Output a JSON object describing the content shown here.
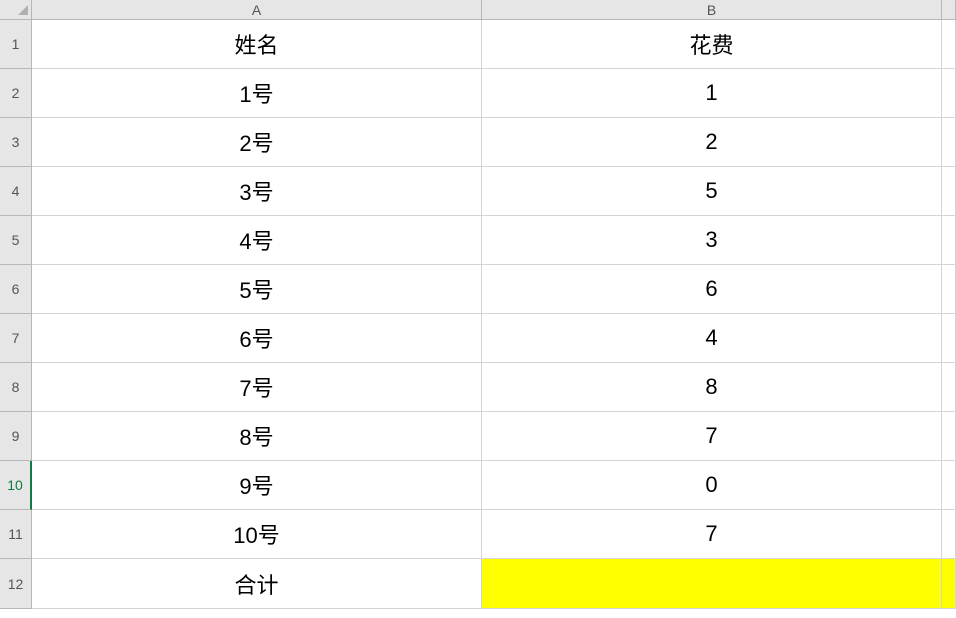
{
  "columns": {
    "A": "A",
    "B": "B"
  },
  "row_numbers": [
    "1",
    "2",
    "3",
    "4",
    "5",
    "6",
    "7",
    "8",
    "9",
    "10",
    "11",
    "12"
  ],
  "table": {
    "header": {
      "name": "姓名",
      "cost": "花费"
    },
    "rows": [
      {
        "name": "1号",
        "cost": "1"
      },
      {
        "name": "2号",
        "cost": "2"
      },
      {
        "name": "3号",
        "cost": "5"
      },
      {
        "name": "4号",
        "cost": "3"
      },
      {
        "name": "5号",
        "cost": "6"
      },
      {
        "name": "6号",
        "cost": "4"
      },
      {
        "name": "7号",
        "cost": "8"
      },
      {
        "name": "8号",
        "cost": "7"
      },
      {
        "name": "9号",
        "cost": "0"
      },
      {
        "name": "10号",
        "cost": "7"
      }
    ],
    "footer": {
      "name": "合计",
      "cost": ""
    }
  },
  "selected_row": "10",
  "highlight_cell": "B12",
  "colors": {
    "header_bg": "#e6e6e6",
    "grid_border": "#d4d4d4",
    "header_border": "#b7b7b7",
    "highlight": "#ffff00",
    "selected": "#107c41"
  }
}
